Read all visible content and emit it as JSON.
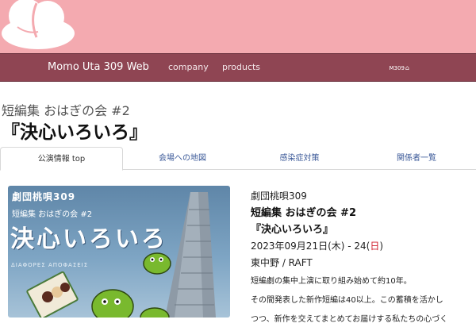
{
  "header": {
    "brand": "Momo Uta 309 Web",
    "nav": [
      {
        "label": "company"
      },
      {
        "label": "products"
      }
    ],
    "member_label": "M309",
    "colors": {
      "banner": "#f4aab0",
      "nav": "#8f4553"
    }
  },
  "page": {
    "subtitle": "短編集 おはぎの会 #2",
    "title": "『決心いろいろ』"
  },
  "tabs": [
    {
      "label": "公演情報 top",
      "active": true
    },
    {
      "label": "会場への地図",
      "active": false
    },
    {
      "label": "感染症対策",
      "active": false
    },
    {
      "label": "関係者一覧",
      "active": false
    }
  ],
  "poster": {
    "troupe": "劇団桃唄309",
    "sub": "短編集 おはぎの会 #2",
    "title": "決心いろいろ",
    "greek": "ΔΙΑΦΟΡΕΣ ΑΠΟΦΑΣΕΙΣ"
  },
  "info": {
    "troupe": "劇団桃唄309",
    "series": "短編集 おはぎの会 #2",
    "title": "『決心いろいろ』",
    "date_main": "2023年09月21日(木) - 24(",
    "date_sun": "日",
    "date_end": ")",
    "venue": "東中野 / RAFT",
    "desc1": "短編劇の集中上演に取り組み始めて約10年。",
    "desc2": "その間発表した新作短編は40以上。この蓄積を活かし",
    "desc3": "つつ、新作を交えてまとめてお届けする私たちの心づく"
  }
}
